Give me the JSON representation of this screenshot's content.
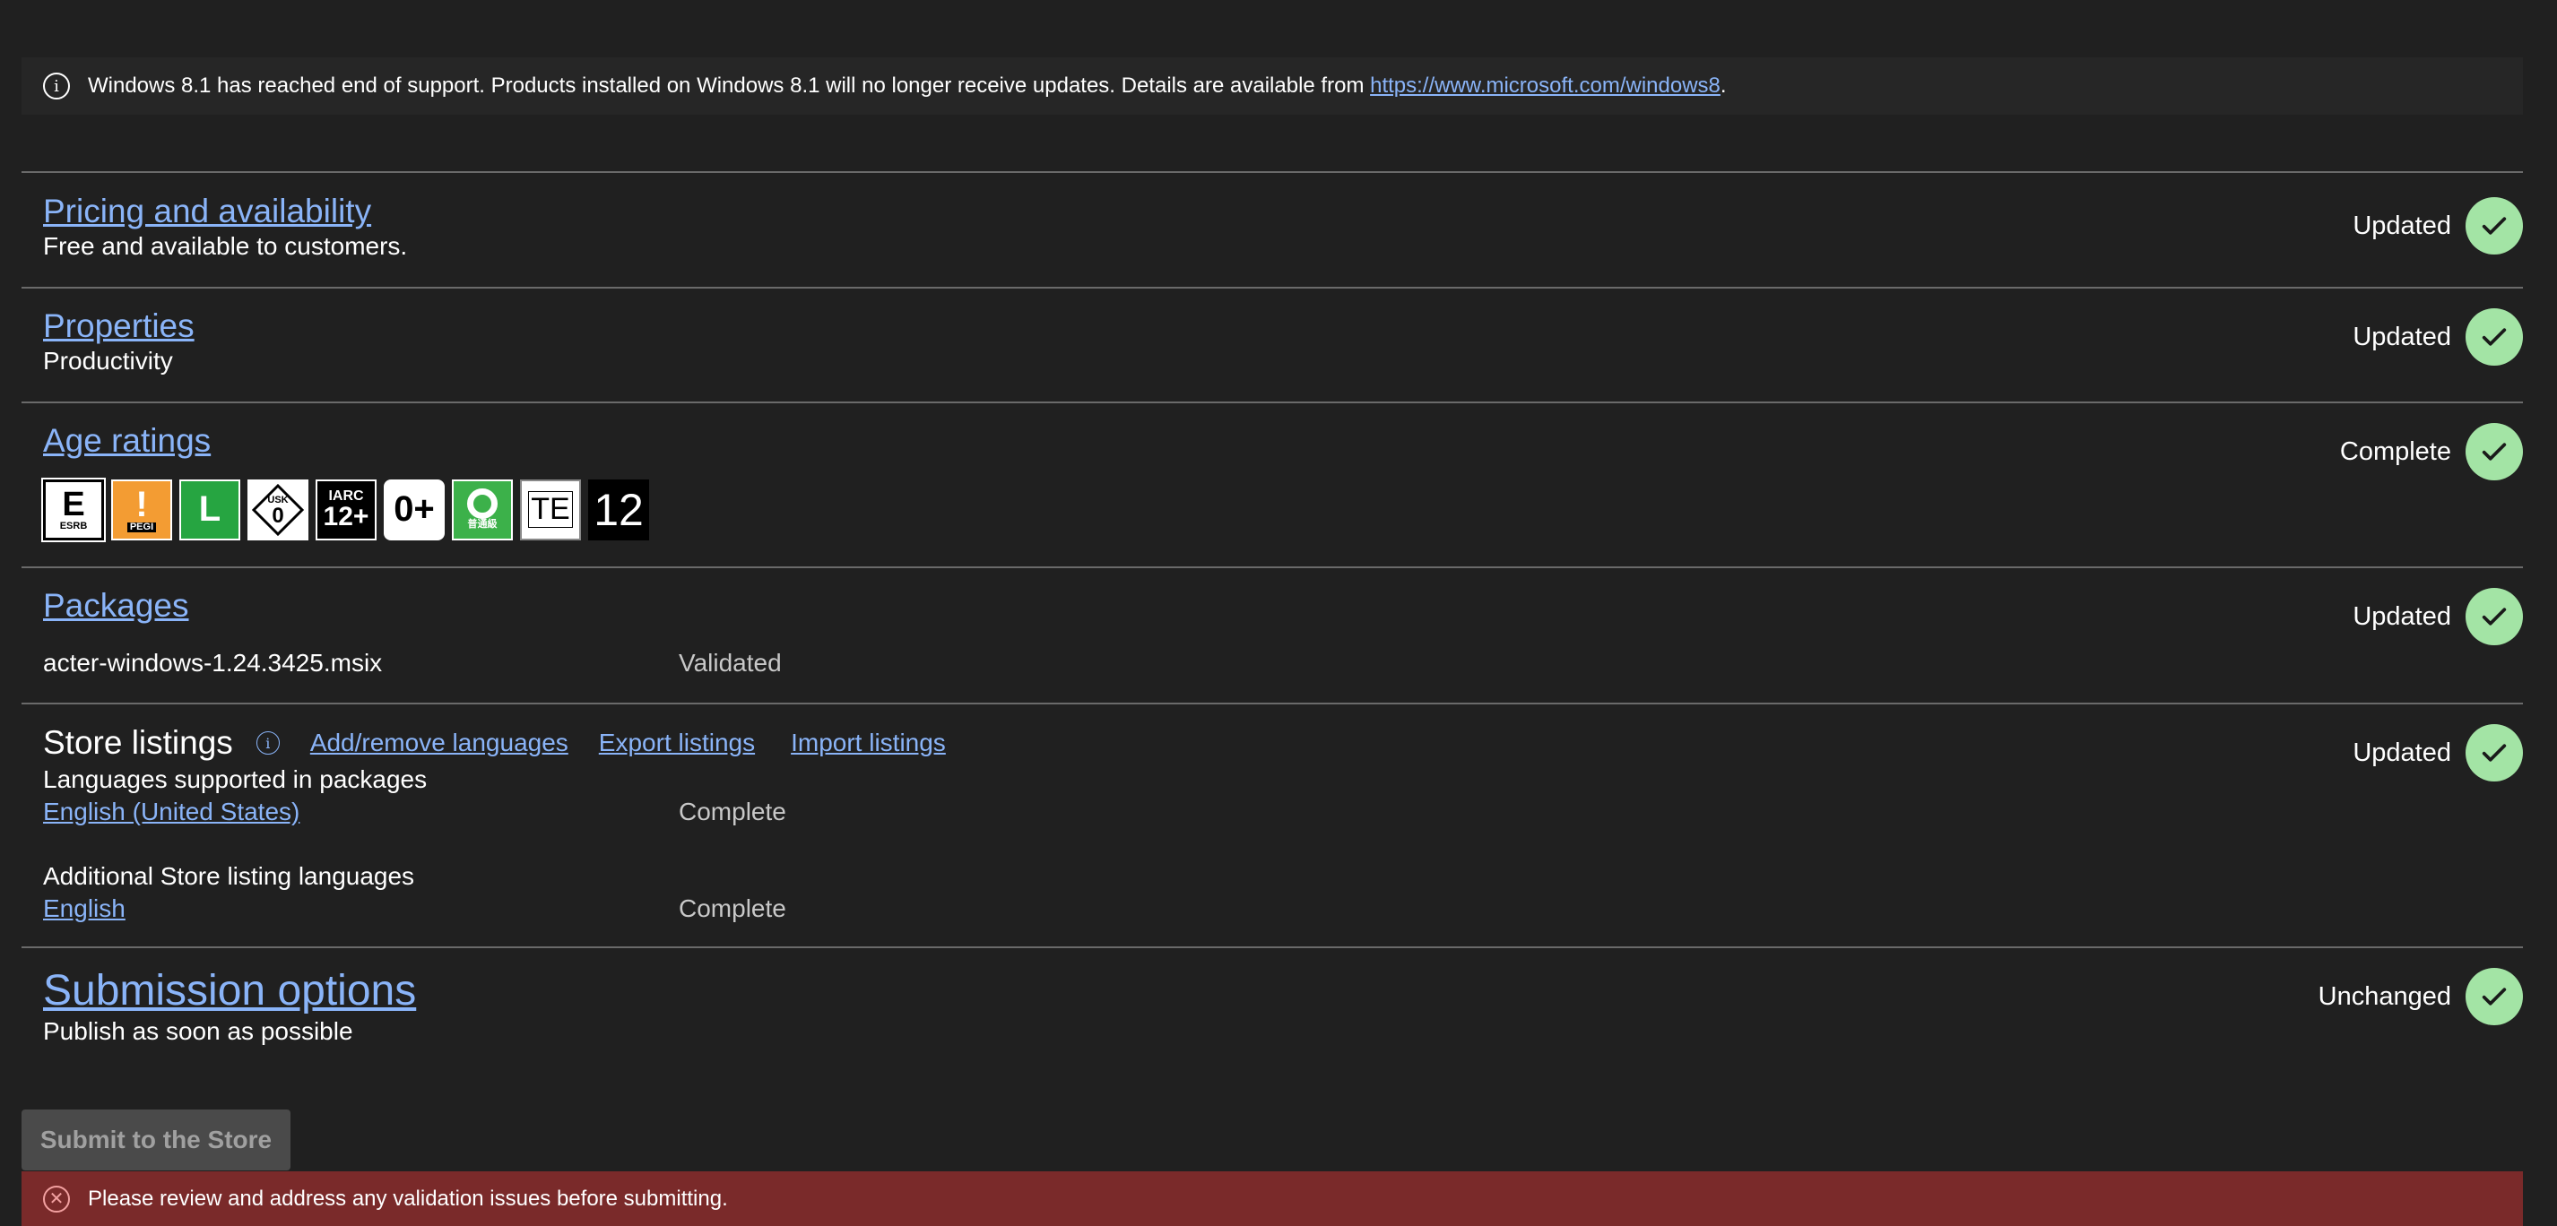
{
  "notice": {
    "text": "Windows 8.1 has reached end of support. Products installed on Windows 8.1 will no longer receive updates. Details are available from ",
    "link": "https://www.microsoft.com/windows8",
    "suffix": ".",
    "icon": "info-icon"
  },
  "pricing": {
    "title": "Pricing and availability",
    "subtitle": "Free and available to customers.",
    "status": "Updated"
  },
  "properties": {
    "title": "Properties",
    "subtitle": "Productivity",
    "status": "Updated"
  },
  "age_ratings": {
    "title": "Age ratings",
    "status": "Complete",
    "badges": [
      {
        "main": "E",
        "sub": "ESRB",
        "name": "esrb-e-badge"
      },
      {
        "main": "!",
        "sub": "PEGI",
        "name": "pegi-badge"
      },
      {
        "main": "L",
        "sub": "",
        "name": "classind-l-badge"
      },
      {
        "main": "0",
        "sub": "USK",
        "name": "usk-0-badge"
      },
      {
        "main": "12+",
        "sub": "IARC",
        "name": "iarc-12-badge"
      },
      {
        "main": "0+",
        "sub": "",
        "name": "acb-0-badge"
      },
      {
        "main": "",
        "sub": "普通級",
        "name": "gsrr-general-badge"
      },
      {
        "main": "TE",
        "sub": "",
        "name": "te-badge"
      },
      {
        "main": "12",
        "sub": "",
        "name": "rating-12-badge"
      }
    ]
  },
  "packages": {
    "title": "Packages",
    "status": "Updated",
    "file": "acter-windows-1.24.3425.msix",
    "file_status": "Validated"
  },
  "store_listings": {
    "title": "Store listings",
    "add_remove": "Add/remove languages",
    "export": "Export listings",
    "import": "Import listings",
    "status": "Updated",
    "supported_label": "Languages supported in packages",
    "supported_lang": "English (United States)",
    "supported_status": "Complete",
    "additional_label": "Additional Store listing languages",
    "additional_lang": "English",
    "additional_status": "Complete"
  },
  "submission": {
    "title": "Submission options",
    "subtitle": "Publish as soon as possible",
    "status": "Unchanged"
  },
  "submit_button": "Submit to the Store",
  "error": {
    "text": "Please review and address any validation issues before submitting.",
    "icon": "error-icon"
  },
  "colors": {
    "background": "#202020",
    "link": "#8ab4f8",
    "check": "#a3e4a5",
    "error_bar": "#7a2a2a"
  }
}
